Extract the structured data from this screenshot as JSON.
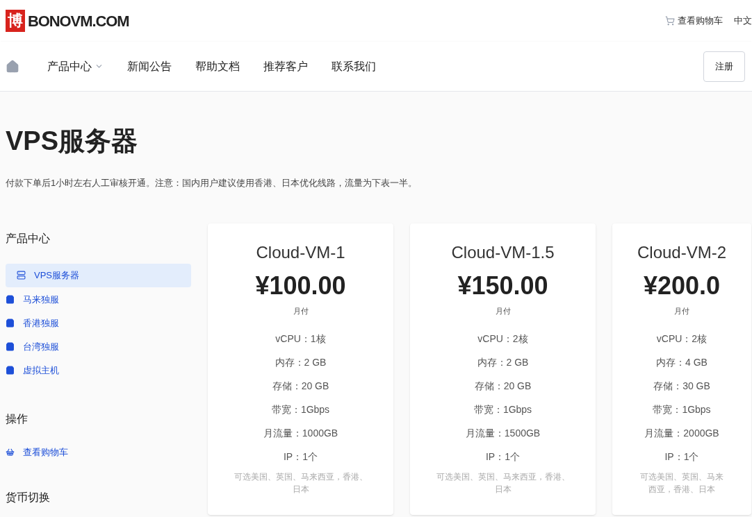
{
  "header": {
    "logo_mark": "博",
    "logo_text": "BONOVM.COM",
    "cart_link": "查看购物车",
    "language": "中文"
  },
  "nav": {
    "items": [
      {
        "label": "产品中心",
        "dropdown": true
      },
      {
        "label": "新闻公告",
        "dropdown": false
      },
      {
        "label": "帮助文档",
        "dropdown": false
      },
      {
        "label": "推荐客户",
        "dropdown": false
      },
      {
        "label": "联系我们",
        "dropdown": false
      }
    ],
    "register": "注册"
  },
  "page": {
    "title": "VPS服务器",
    "description": "付款下单后1小时左右人工审核开通。注意：国内用户建议使用香港、日本优化线路，流量为下表一半。"
  },
  "sidebar": {
    "categories_title": "产品中心",
    "categories": [
      {
        "label": "VPS服务器",
        "selected": true
      },
      {
        "label": "马来独服",
        "selected": false
      },
      {
        "label": "香港独服",
        "selected": false
      },
      {
        "label": "台湾独服",
        "selected": false
      },
      {
        "label": "虚拟主机",
        "selected": false
      }
    ],
    "actions_title": "操作",
    "actions": [
      "查看购物车"
    ],
    "currency_title": "货币切换"
  },
  "products": [
    {
      "name": "Cloud-VM-1",
      "price": "¥100.00",
      "cycle": "月付",
      "specs": [
        "vCPU：1核",
        "内存：2 GB",
        "存储：20 GB",
        "带宽：1Gbps",
        "月流量：1000GB",
        "IP：1个"
      ],
      "note": "可选美国、英国、马来西亚，香港、日本"
    },
    {
      "name": "Cloud-VM-1.5",
      "price": "¥150.00",
      "cycle": "月付",
      "specs": [
        "vCPU：2核",
        "内存：2 GB",
        "存储：20 GB",
        "带宽：1Gbps",
        "月流量：1500GB",
        "IP：1个"
      ],
      "note": "可选美国、英国、马来西亚，香港、日本"
    },
    {
      "name": "Cloud-VM-2",
      "price": "¥200.0",
      "cycle": "月付",
      "specs": [
        "vCPU：2核",
        "内存：4 GB",
        "存储：30 GB",
        "带宽：1Gbps",
        "月流量：2000GB",
        "IP：1个"
      ],
      "note": "可选美国、英国、马来西亚，香港、日本"
    }
  ]
}
